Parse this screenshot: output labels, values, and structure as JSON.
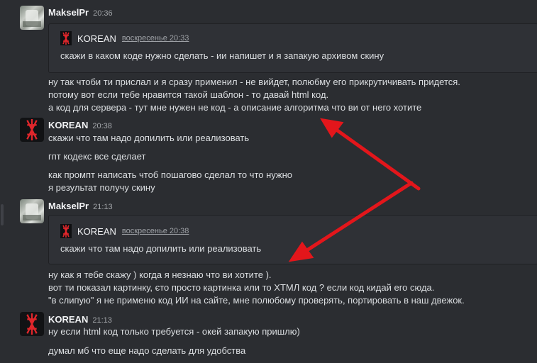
{
  "colors": {
    "background": "#2b2d31",
    "text": "#dbdee1",
    "arrow": "#e3161b",
    "rune": "#e0262b"
  },
  "messages": [
    {
      "author": "MakselPr",
      "time": "20:36",
      "quote": {
        "author": "KOREAN",
        "date": "воскресенье 20:33",
        "text": "скажи в каком коде нужно сделать - ии напишет и я запакую архивом скину"
      },
      "lines": [
        "ну так чтоби ти прислал и я сразу применил - не вийдет, полюбму его прикрутичивать придется.",
        "потому вот если тебе нравится такой шаблон - то давай html код.",
        "а код для сервера - тут мне нужен не код - а описание алгоритма что ви от него хотите"
      ]
    },
    {
      "author": "KOREAN",
      "time": "20:38",
      "lines": [
        "скажи что там надо допилить или реализовать",
        "гпт кодекс все сделает",
        "как промпт написать чтоб пошагово сделал то что нужно",
        "я результат получу скину"
      ]
    },
    {
      "author": "MakselPr",
      "time": "21:13",
      "quote": {
        "author": "KOREAN",
        "date": "воскресенье 20:38",
        "text": "скажи что там надо допилить или реализовать"
      },
      "lines": [
        "ну как я тебе скажу ) когда я незнаю что ви хотите ).",
        "вот ти показал картинку, єто просто картинка или то ХТМЛ код ? если код кидай его сюда.",
        "\"в слипую\" я не применю код ИИ на сайте, мне полюбому проверять, портировать в наш двежок."
      ]
    },
    {
      "author": "KOREAN",
      "time": "21:13",
      "lines": [
        "ну если html код только требуется - окей запакую пришлю)",
        "думал мб что еще надо сделать для удобства"
      ]
    }
  ]
}
